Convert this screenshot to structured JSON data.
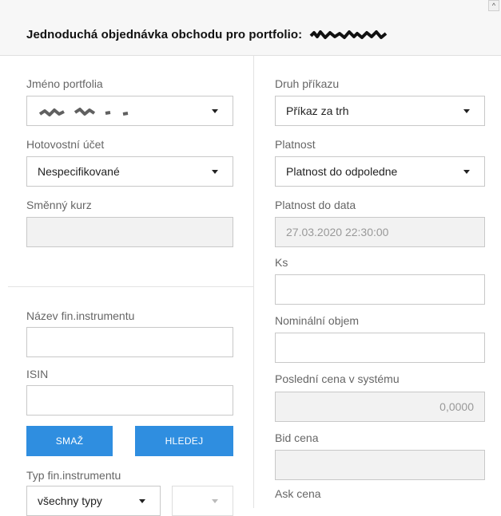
{
  "header": {
    "title": "Jednoduchá objednávka obchodu pro portfolio:"
  },
  "left": {
    "portfolio_label": "Jméno portfolia",
    "cash_account_label": "Hotovostní účet",
    "cash_account_value": "Nespecifikované",
    "exchange_rate_label": "Směnný kurz",
    "exchange_rate_value": "",
    "instrument_name_label": "Název fin.instrumentu",
    "instrument_name_value": "",
    "isin_label": "ISIN",
    "isin_value": "",
    "clear_button": "SMAŽ",
    "search_button": "HLEDEJ",
    "instrument_type_label": "Typ fin.instrumentu",
    "instrument_type_value": "všechny typy",
    "instrument_subtype_value": ""
  },
  "right": {
    "order_type_label": "Druh příkazu",
    "order_type_value": "Příkaz za trh",
    "validity_label": "Platnost",
    "validity_value": "Platnost do odpoledne",
    "valid_until_label": "Platnost do data",
    "valid_until_value": "27.03.2020 22:30:00",
    "pieces_label": "Ks",
    "pieces_value": "",
    "nominal_label": "Nominální objem",
    "nominal_value": "",
    "last_price_label": "Poslední cena v systému",
    "last_price_value": "0,0000",
    "bid_label": "Bid cena",
    "bid_value": "",
    "ask_label": "Ask cena"
  }
}
